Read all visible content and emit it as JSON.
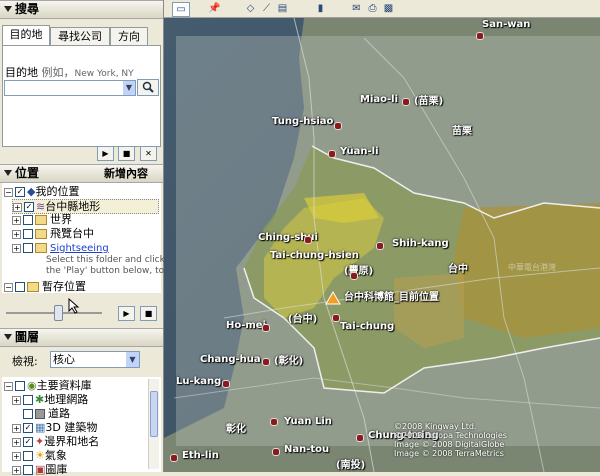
{
  "search": {
    "title": "搜尋",
    "tabs": [
      "目的地",
      "尋找公司",
      "方向"
    ],
    "field_label": "目的地",
    "example_prefix": "例如，",
    "example_value": "New York, NY",
    "input_value": ""
  },
  "places": {
    "title": "位置",
    "add_button": "新增內容",
    "items": [
      {
        "label": "我的位置"
      },
      {
        "label": "台中縣地形"
      },
      {
        "label": "世界"
      },
      {
        "label": "飛覽台中"
      },
      {
        "label": "Sightseeing"
      },
      {
        "label": "暫存位置"
      }
    ],
    "sightseeing_desc": [
      "Select this folder and click o",
      "the 'Play' button below, to"
    ]
  },
  "layers": {
    "title": "圖層",
    "view_label": "檢視:",
    "view_value": "核心",
    "items": [
      {
        "label": "主要資料庫"
      },
      {
        "label": "地理網路"
      },
      {
        "label": "道路"
      },
      {
        "label": "3D 建築物"
      },
      {
        "label": "邊界和地名"
      },
      {
        "label": "氣象"
      },
      {
        "label": "圖庫"
      }
    ]
  },
  "map": {
    "places": [
      {
        "name": "San-wan"
      },
      {
        "name": "Miao-li"
      },
      {
        "name": "(苗栗)"
      },
      {
        "name": "苗栗"
      },
      {
        "name": "Tung-hsiao"
      },
      {
        "name": "Yüan-li"
      },
      {
        "name": "Ching-shui"
      },
      {
        "name": "Tai-chung-hsien"
      },
      {
        "name": "(豐原)"
      },
      {
        "name": "Shih-kang"
      },
      {
        "name": "台中"
      },
      {
        "name": "台中科博館_目前位置"
      },
      {
        "name": "(台中)"
      },
      {
        "name": "Tai-chung"
      },
      {
        "name": "Ho-mei"
      },
      {
        "name": "Chang-hua"
      },
      {
        "name": "(彰化)"
      },
      {
        "name": "Lu-kang"
      },
      {
        "name": "彰化"
      },
      {
        "name": "Yuan Lin"
      },
      {
        "name": "Eth-lin"
      },
      {
        "name": "Nan-tou"
      },
      {
        "name": "(南投)"
      },
      {
        "name": "Chung-hsing"
      },
      {
        "name": "中華電台港灣"
      }
    ],
    "copyright": [
      "©2008 Kingway Ltd.",
      "©2008 Europa Technologies",
      "Image © 2008 DigitalGlobe",
      "Image © 2008 TerraMetrics"
    ]
  }
}
